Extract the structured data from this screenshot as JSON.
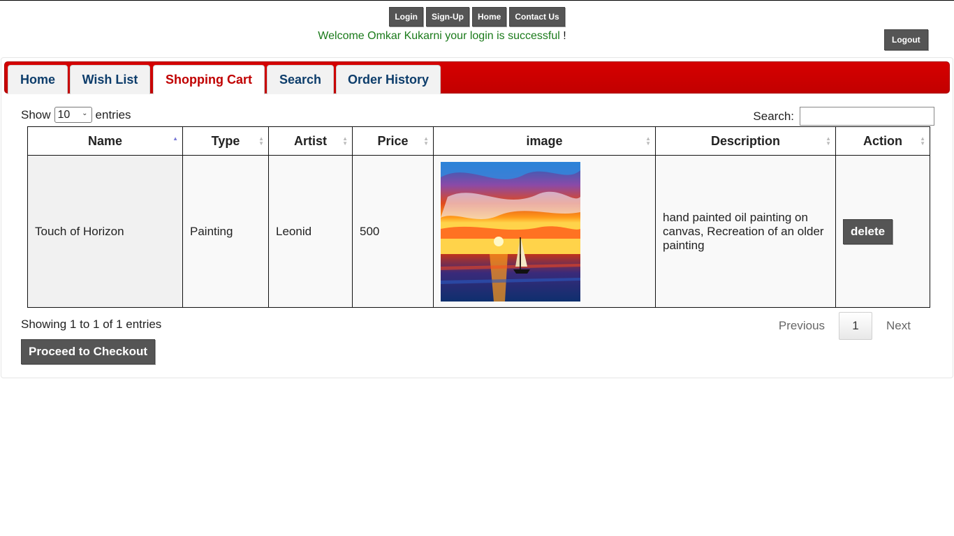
{
  "topnav": {
    "login": "Login",
    "signup": "Sign-Up",
    "home": "Home",
    "contact": "Contact Us"
  },
  "welcome": {
    "text": "Welcome Omkar Kukarni your login is successful",
    "bang": "!"
  },
  "logout": "Logout",
  "tabs": [
    {
      "label": "Home",
      "active": false
    },
    {
      "label": "Wish List",
      "active": false
    },
    {
      "label": "Shopping Cart",
      "active": true
    },
    {
      "label": "Search",
      "active": false
    },
    {
      "label": "Order History",
      "active": false
    }
  ],
  "table_controls": {
    "show_label": "Show",
    "length_value": "10",
    "entries_label": "entries",
    "search_label": "Search:",
    "search_value": ""
  },
  "table": {
    "columns": [
      "Name",
      "Type",
      "Artist",
      "Price",
      "image",
      "Description",
      "Action"
    ],
    "sorted_column": "Name",
    "sort_direction": "asc",
    "rows": [
      {
        "name": "Touch of Horizon",
        "type": "Painting",
        "artist": "Leonid",
        "price": "500",
        "image_icon": "sunset-sailboat-painting",
        "description": "hand painted oil painting on canvas, Recreation of an older painting",
        "action": "delete"
      }
    ]
  },
  "info": "Showing 1 to 1 of 1 entries",
  "pagination": {
    "previous": "Previous",
    "current": "1",
    "next": "Next"
  },
  "checkout": "Proceed to Checkout",
  "colors": {
    "tab_bar": "#cc0000",
    "active_tab_text": "#c00000",
    "tab_text": "#0d3d6b",
    "button_bg": "#555555",
    "welcome_text": "#1a7a1a"
  }
}
